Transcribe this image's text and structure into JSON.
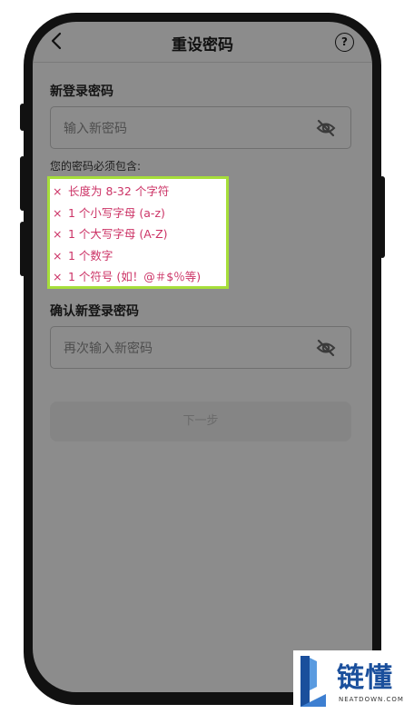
{
  "header": {
    "title": "重设密码",
    "help_symbol": "?"
  },
  "new_password": {
    "label": "新登录密码",
    "placeholder": "输入新密码",
    "value": "",
    "visibility_icon": "eye-off-icon"
  },
  "requirements": {
    "title": "您的密码必须包含:",
    "marker": "×",
    "items": [
      {
        "label": "长度为 8-32 个字符",
        "met": false
      },
      {
        "label": "1 个小写字母 (a-z)",
        "met": false
      },
      {
        "label": "1 个大写字母 (A-Z)",
        "met": false
      },
      {
        "label": "1 个数字",
        "met": false
      },
      {
        "label": "1 个符号 (如！@＃$％等)",
        "met": false
      }
    ],
    "highlight_color": "#a6de3a",
    "unmet_color": "#cc3366"
  },
  "confirm_password": {
    "label": "确认新登录密码",
    "placeholder": "再次输入新密码",
    "value": "",
    "visibility_icon": "eye-off-icon"
  },
  "next_button": {
    "label": "下一步",
    "enabled": false
  },
  "watermark": {
    "brand": "链懂",
    "site": "NEATDOWN.COM"
  }
}
